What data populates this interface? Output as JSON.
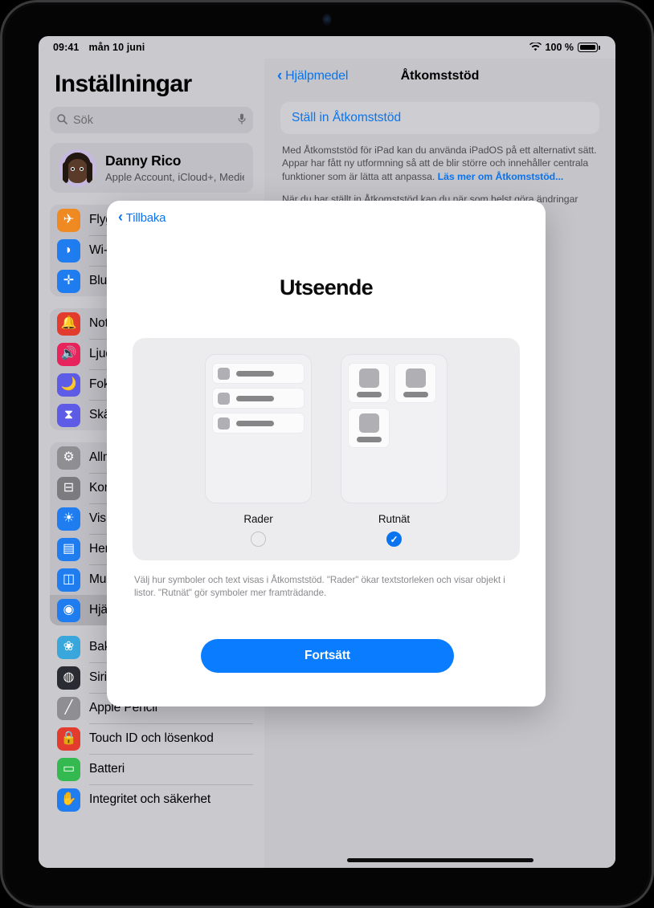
{
  "status_bar": {
    "time": "09:41",
    "date": "mån 10 juni",
    "wifi_icon": "wifi-icon",
    "battery_percent": "100 %",
    "battery_icon": "battery-icon"
  },
  "sidebar": {
    "title": "Inställningar",
    "search": {
      "placeholder": "Sök",
      "value": "",
      "search_icon": "search-icon",
      "mic_icon": "microphone-icon"
    },
    "account": {
      "name": "Danny Rico",
      "subtitle": "Apple Account, iCloud+, Medie...",
      "avatar_icon": "memoji-avatar"
    },
    "groups": [
      {
        "items": [
          {
            "label": "Flygplansläge",
            "icon": "airplane-icon",
            "color": "#ef8a22",
            "glyph": "✈"
          },
          {
            "label": "Wi-Fi",
            "icon": "wifi-icon",
            "color": "#1f7df0",
            "glyph": "◗"
          },
          {
            "label": "Bluetooth",
            "icon": "bluetooth-icon",
            "color": "#1f7df0",
            "glyph": "✛"
          }
        ]
      },
      {
        "items": [
          {
            "label": "Notiser",
            "icon": "bell-icon",
            "color": "#e33b2e",
            "glyph": "🔔"
          },
          {
            "label": "Ljud",
            "icon": "speaker-icon",
            "color": "#e8245c",
            "glyph": "🔊"
          },
          {
            "label": "Fokus",
            "icon": "moon-icon",
            "color": "#5e5ce6",
            "glyph": "🌙"
          },
          {
            "label": "Skärmtid",
            "icon": "hourglass-icon",
            "color": "#5e5ce6",
            "glyph": "⧗"
          }
        ]
      },
      {
        "items": [
          {
            "label": "Allmänt",
            "icon": "gear-icon",
            "color": "#8e8e93",
            "glyph": "⚙"
          },
          {
            "label": "Kontrollcenter",
            "icon": "toggles-icon",
            "color": "#7b7b80",
            "glyph": "⊟"
          },
          {
            "label": "Visning och ljusstyrka",
            "icon": "brightness-icon",
            "color": "#1f7df0",
            "glyph": "☀"
          },
          {
            "label": "Hemskärm och appbibliotek",
            "icon": "home-screen-icon",
            "color": "#1f7df0",
            "glyph": "▤"
          },
          {
            "label": "Multitasking och gester",
            "icon": "multitasking-icon",
            "color": "#1f7df0",
            "glyph": "◫"
          },
          {
            "label": "Hjälpmedel",
            "icon": "accessibility-icon",
            "color": "#1f7df0",
            "glyph": "◉",
            "selected": true
          }
        ]
      },
      {
        "plain": true,
        "items": [
          {
            "label": "Bakgrundsbild",
            "icon": "wallpaper-icon",
            "color": "#39a7dc",
            "glyph": "❀"
          },
          {
            "label": "Siri och sökning",
            "icon": "siri-icon",
            "color": "#2b2b33",
            "glyph": "◍"
          },
          {
            "label": "Apple Pencil",
            "icon": "apple-pencil-icon",
            "color": "#8e8e93",
            "glyph": "╱"
          },
          {
            "label": "Touch ID och lösenkod",
            "icon": "lock-icon",
            "color": "#e33b2e",
            "glyph": "🔒"
          },
          {
            "label": "Batteri",
            "icon": "battery-icon",
            "color": "#33b94f",
            "glyph": "▭"
          },
          {
            "label": "Integritet och säkerhet",
            "icon": "privacy-hand-icon",
            "color": "#1f7df0",
            "glyph": "✋"
          }
        ]
      }
    ]
  },
  "detail": {
    "back_label": "Hjälpmedel",
    "title": "Åtkomststöd",
    "setup_link": "Ställ in Åtkomststöd",
    "paragraph_1": "Med Åtkomststöd för iPad kan du använda iPadOS på ett alternativt sätt. Appar har fått ny utformning så att de blir större och innehåller centrala funktioner som är lätta att anpassa. ",
    "paragraph_1_link": "Läs mer om Åtkomststöd...",
    "paragraph_2": "När du har ställt in Åtkomststöd kan du när som helst göra ändringar"
  },
  "modal": {
    "back_label": "Tillbaka",
    "title": "Utseende",
    "options": [
      {
        "label": "Rader",
        "selected": false,
        "preview": "rows-preview",
        "rows": 3
      },
      {
        "label": "Rutnät",
        "selected": true,
        "preview": "grid-preview",
        "tiles": 3,
        "check_glyph": "✓"
      }
    ],
    "description": "Välj hur symboler och text visas i Åtkomststöd. \"Rader\" ökar textstorleken och visar objekt i listor. \"Rutnät\" gör symboler mer framträdande.",
    "continue_label": "Fortsätt"
  },
  "colors": {
    "accent_blue": "#0a7cff",
    "link_blue": "#0a74ef",
    "screen_bg": "#c9c9ce",
    "modal_bg": "#ffffff"
  }
}
